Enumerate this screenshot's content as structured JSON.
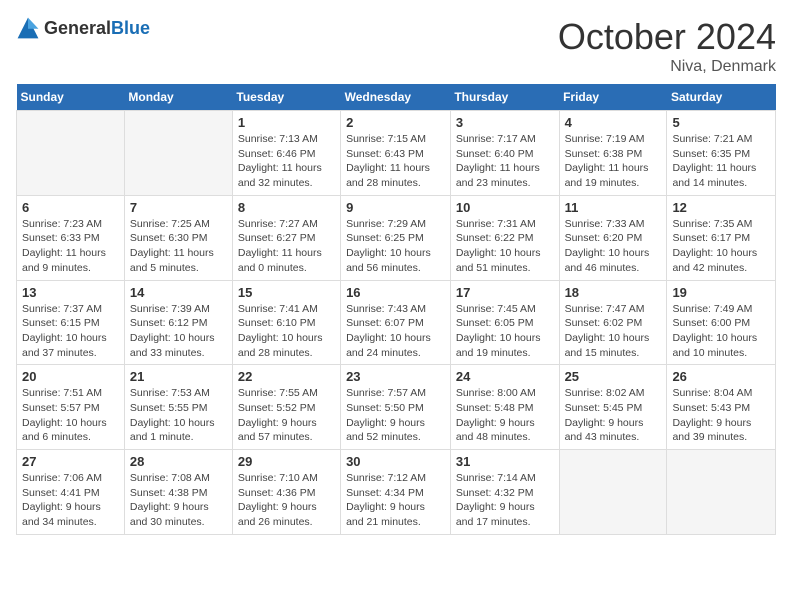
{
  "header": {
    "logo_general": "General",
    "logo_blue": "Blue",
    "month": "October 2024",
    "location": "Niva, Denmark"
  },
  "days_of_week": [
    "Sunday",
    "Monday",
    "Tuesday",
    "Wednesday",
    "Thursday",
    "Friday",
    "Saturday"
  ],
  "weeks": [
    [
      {
        "day": "",
        "content": ""
      },
      {
        "day": "",
        "content": ""
      },
      {
        "day": "1",
        "content": "Sunrise: 7:13 AM\nSunset: 6:46 PM\nDaylight: 11 hours\nand 32 minutes."
      },
      {
        "day": "2",
        "content": "Sunrise: 7:15 AM\nSunset: 6:43 PM\nDaylight: 11 hours\nand 28 minutes."
      },
      {
        "day": "3",
        "content": "Sunrise: 7:17 AM\nSunset: 6:40 PM\nDaylight: 11 hours\nand 23 minutes."
      },
      {
        "day": "4",
        "content": "Sunrise: 7:19 AM\nSunset: 6:38 PM\nDaylight: 11 hours\nand 19 minutes."
      },
      {
        "day": "5",
        "content": "Sunrise: 7:21 AM\nSunset: 6:35 PM\nDaylight: 11 hours\nand 14 minutes."
      }
    ],
    [
      {
        "day": "6",
        "content": "Sunrise: 7:23 AM\nSunset: 6:33 PM\nDaylight: 11 hours\nand 9 minutes."
      },
      {
        "day": "7",
        "content": "Sunrise: 7:25 AM\nSunset: 6:30 PM\nDaylight: 11 hours\nand 5 minutes."
      },
      {
        "day": "8",
        "content": "Sunrise: 7:27 AM\nSunset: 6:27 PM\nDaylight: 11 hours\nand 0 minutes."
      },
      {
        "day": "9",
        "content": "Sunrise: 7:29 AM\nSunset: 6:25 PM\nDaylight: 10 hours\nand 56 minutes."
      },
      {
        "day": "10",
        "content": "Sunrise: 7:31 AM\nSunset: 6:22 PM\nDaylight: 10 hours\nand 51 minutes."
      },
      {
        "day": "11",
        "content": "Sunrise: 7:33 AM\nSunset: 6:20 PM\nDaylight: 10 hours\nand 46 minutes."
      },
      {
        "day": "12",
        "content": "Sunrise: 7:35 AM\nSunset: 6:17 PM\nDaylight: 10 hours\nand 42 minutes."
      }
    ],
    [
      {
        "day": "13",
        "content": "Sunrise: 7:37 AM\nSunset: 6:15 PM\nDaylight: 10 hours\nand 37 minutes."
      },
      {
        "day": "14",
        "content": "Sunrise: 7:39 AM\nSunset: 6:12 PM\nDaylight: 10 hours\nand 33 minutes."
      },
      {
        "day": "15",
        "content": "Sunrise: 7:41 AM\nSunset: 6:10 PM\nDaylight: 10 hours\nand 28 minutes."
      },
      {
        "day": "16",
        "content": "Sunrise: 7:43 AM\nSunset: 6:07 PM\nDaylight: 10 hours\nand 24 minutes."
      },
      {
        "day": "17",
        "content": "Sunrise: 7:45 AM\nSunset: 6:05 PM\nDaylight: 10 hours\nand 19 minutes."
      },
      {
        "day": "18",
        "content": "Sunrise: 7:47 AM\nSunset: 6:02 PM\nDaylight: 10 hours\nand 15 minutes."
      },
      {
        "day": "19",
        "content": "Sunrise: 7:49 AM\nSunset: 6:00 PM\nDaylight: 10 hours\nand 10 minutes."
      }
    ],
    [
      {
        "day": "20",
        "content": "Sunrise: 7:51 AM\nSunset: 5:57 PM\nDaylight: 10 hours\nand 6 minutes."
      },
      {
        "day": "21",
        "content": "Sunrise: 7:53 AM\nSunset: 5:55 PM\nDaylight: 10 hours\nand 1 minute."
      },
      {
        "day": "22",
        "content": "Sunrise: 7:55 AM\nSunset: 5:52 PM\nDaylight: 9 hours\nand 57 minutes."
      },
      {
        "day": "23",
        "content": "Sunrise: 7:57 AM\nSunset: 5:50 PM\nDaylight: 9 hours\nand 52 minutes."
      },
      {
        "day": "24",
        "content": "Sunrise: 8:00 AM\nSunset: 5:48 PM\nDaylight: 9 hours\nand 48 minutes."
      },
      {
        "day": "25",
        "content": "Sunrise: 8:02 AM\nSunset: 5:45 PM\nDaylight: 9 hours\nand 43 minutes."
      },
      {
        "day": "26",
        "content": "Sunrise: 8:04 AM\nSunset: 5:43 PM\nDaylight: 9 hours\nand 39 minutes."
      }
    ],
    [
      {
        "day": "27",
        "content": "Sunrise: 7:06 AM\nSunset: 4:41 PM\nDaylight: 9 hours\nand 34 minutes."
      },
      {
        "day": "28",
        "content": "Sunrise: 7:08 AM\nSunset: 4:38 PM\nDaylight: 9 hours\nand 30 minutes."
      },
      {
        "day": "29",
        "content": "Sunrise: 7:10 AM\nSunset: 4:36 PM\nDaylight: 9 hours\nand 26 minutes."
      },
      {
        "day": "30",
        "content": "Sunrise: 7:12 AM\nSunset: 4:34 PM\nDaylight: 9 hours\nand 21 minutes."
      },
      {
        "day": "31",
        "content": "Sunrise: 7:14 AM\nSunset: 4:32 PM\nDaylight: 9 hours\nand 17 minutes."
      },
      {
        "day": "",
        "content": ""
      },
      {
        "day": "",
        "content": ""
      }
    ]
  ]
}
